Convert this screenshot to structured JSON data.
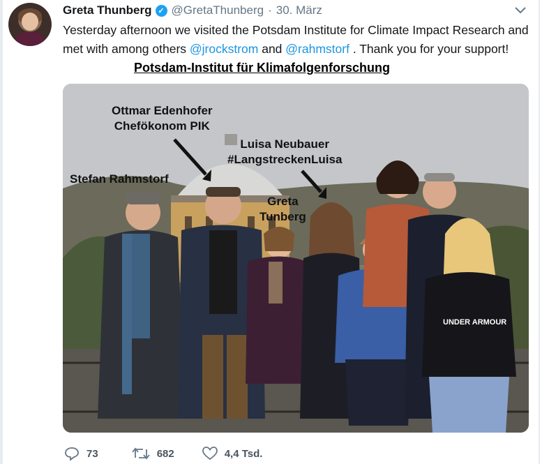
{
  "tweet": {
    "author_name": "Greta Thunberg",
    "handle": "@GretaThunberg",
    "separator": "·",
    "date": "30. März",
    "text_part1": "Yesterday afternoon we visited the Potsdam Institute for Climate Impact Research and met with among others ",
    "mention1": "@jrockstrom",
    "text_part2": " and ",
    "mention2": "@rahmstorf",
    "text_part3": " . Thank you for your support!"
  },
  "overlay": {
    "title": "Potsdam-Institut für Klimafolgenforschung"
  },
  "photo_labels": {
    "edenhofer_line1": "Ottmar Edenhofer",
    "edenhofer_line2": "Chefökonom PIK",
    "neubauer_line1": "Luisa Neubauer",
    "neubauer_line2": "#LangstreckenLuisa",
    "rahmstorf": "Stefan Rahmstorf",
    "greta_line1": "Greta",
    "greta_line2": "Tunberg"
  },
  "actions": {
    "replies": "73",
    "retweets": "682",
    "likes": "4,4 Tsd."
  },
  "colors": {
    "link": "#1b95e0",
    "verified": "#1da1f2",
    "secondary_text": "#657786"
  },
  "icons": [
    "verified-badge-icon",
    "chevron-down-icon",
    "reply-icon",
    "retweet-icon",
    "like-icon"
  ]
}
